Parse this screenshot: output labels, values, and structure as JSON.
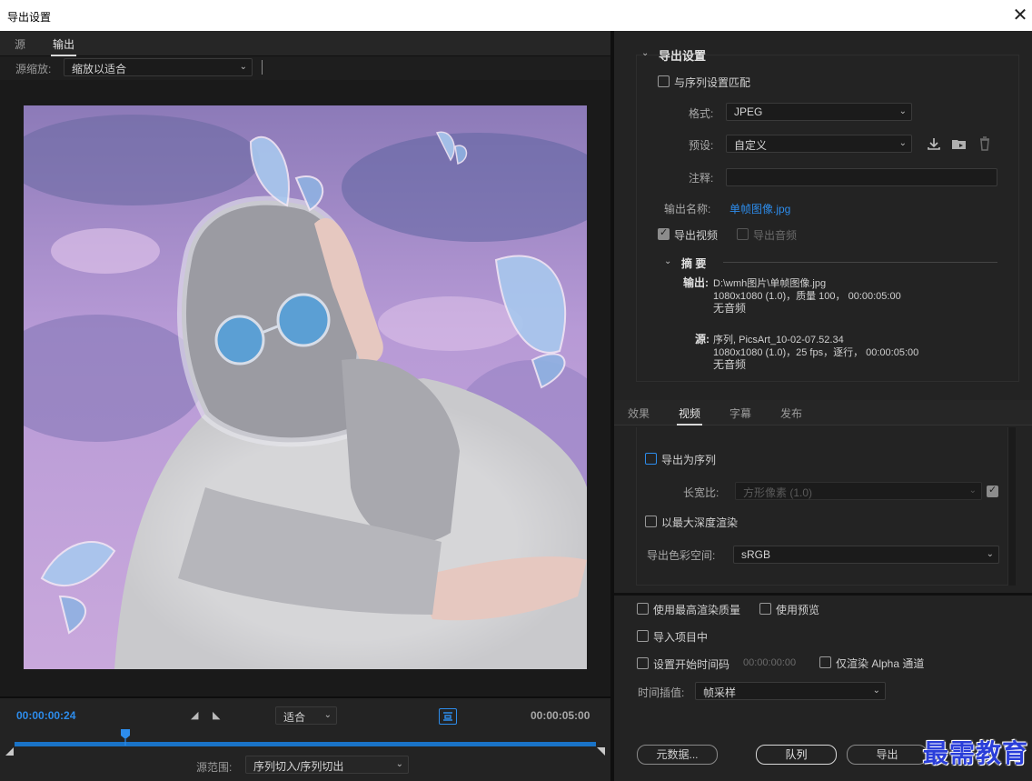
{
  "window": {
    "title": "导出设置",
    "close_glyph": "✕"
  },
  "left": {
    "tabs": [
      "源",
      "输出"
    ],
    "source_scale_label": "源缩放:",
    "source_scale_value": "缩放以适合",
    "timeline": {
      "current_time": "00:00:00:24",
      "end_time": "00:00:05:00",
      "fit_value": "适合",
      "source_range_label": "源范围:",
      "source_range_value": "序列切入/序列切出",
      "playhead_fraction": 0.19
    }
  },
  "right": {
    "export_settings": {
      "heading": "导出设置",
      "match_sequence_label": "与序列设置匹配",
      "format_label": "格式:",
      "format_value": "JPEG",
      "preset_label": "预设:",
      "preset_value": "自定义",
      "comments_label": "注释:",
      "comments_value": "",
      "output_name_label": "输出名称:",
      "output_name_value": "单帧图像.jpg",
      "export_video_label": "导出视频",
      "export_audio_label": "导出音频"
    },
    "summary": {
      "heading": "摘 要",
      "output_label": "输出:",
      "output_lines": [
        "D:\\wmh图片\\单帧图像.jpg",
        "1080x1080 (1.0)，质量 100， 00:00:05:00",
        "无音频"
      ],
      "source_label": "源:",
      "source_lines": [
        "序列, PicsArt_10-02-07.52.34",
        "1080x1080 (1.0)，25 fps，逐行， 00:00:05:00",
        "无音频"
      ]
    },
    "tabs": [
      "效果",
      "视频",
      "字幕",
      "发布"
    ],
    "video": {
      "export_as_sequence_label": "导出为序列",
      "aspect_label": "长宽比:",
      "aspect_value": "方形像素 (1.0)",
      "max_depth_label": "以最大深度渲染",
      "color_space_label": "导出色彩空间:",
      "color_space_value": "sRGB"
    },
    "bottom": {
      "max_quality_label": "使用最高渲染质量",
      "use_previews_label": "使用预览",
      "import_project_label": "导入项目中",
      "set_start_tc_label": "设置开始时间码",
      "start_tc_value": "00:00:00:00",
      "render_alpha_label": "仅渲染 Alpha 通道",
      "time_interp_label": "时间插值:",
      "time_interp_value": "帧采样",
      "metadata_button": "元数据...",
      "queue_button": "队列",
      "export_button": "导出"
    },
    "watermark": "最需教育"
  }
}
